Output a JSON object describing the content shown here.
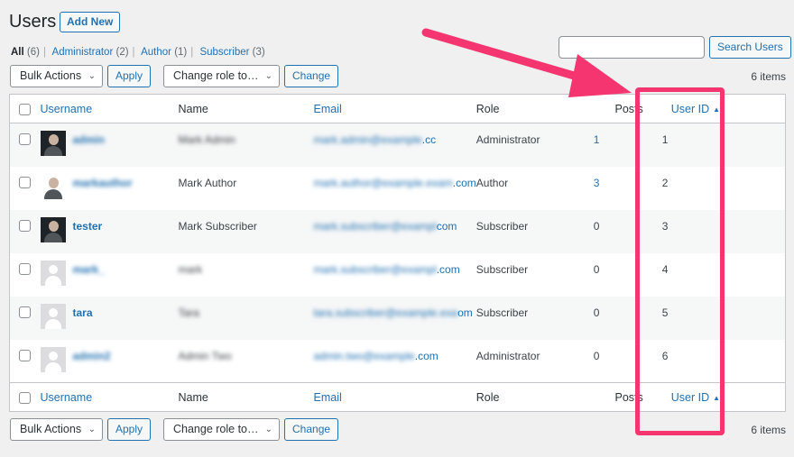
{
  "header": {
    "title": "Users",
    "add_new_label": "Add New"
  },
  "filters": [
    {
      "label": "All",
      "count": "(6)"
    },
    {
      "label": "Administrator",
      "count": "(2)"
    },
    {
      "label": "Author",
      "count": "(1)"
    },
    {
      "label": "Subscriber",
      "count": "(3)"
    }
  ],
  "search": {
    "button_label": "Search Users",
    "value": ""
  },
  "tablenav": {
    "bulk_actions_label": "Bulk Actions",
    "apply_label": "Apply",
    "change_role_label": "Change role to…",
    "change_label": "Change",
    "items_count": "6 items"
  },
  "columns": {
    "username": "Username",
    "name": "Name",
    "email": "Email",
    "role": "Role",
    "posts": "Posts",
    "user_id": "User ID"
  },
  "rows": [
    {
      "username": "admin",
      "name": "Mark Admin",
      "email_a": "mark.admin@example",
      "email_b": ".cc",
      "role": "Administrator",
      "posts": "1",
      "user_id": "1",
      "avatar": "photo"
    },
    {
      "username": "markauthor",
      "name": "Mark Author",
      "email_a": "mark.author@example.exam",
      "email_b": ".com",
      "role": "Author",
      "posts": "3",
      "user_id": "2",
      "avatar": "photo-light"
    },
    {
      "username": "tester",
      "name": "Mark Subscriber",
      "email_a": "mark.subscriber@exampl",
      "email_b": "com",
      "role": "Subscriber",
      "posts": "0",
      "user_id": "3",
      "avatar": "photo"
    },
    {
      "username": "mark_",
      "name": "mark",
      "email_a": "mark.subscriber@exampl",
      "email_b": ".com",
      "role": "Subscriber",
      "posts": "0",
      "user_id": "4",
      "avatar": "default"
    },
    {
      "username": "tara",
      "name": "Tara",
      "email_a": "tara.subscriber@example.exa",
      "email_b": "om",
      "role": "Subscriber",
      "posts": "0",
      "user_id": "5",
      "avatar": "default"
    },
    {
      "username": "admin2",
      "name": "Admin Two",
      "email_a": "admin.two@example",
      "email_b": ".com",
      "role": "Administrator",
      "posts": "0",
      "user_id": "6",
      "avatar": "default"
    }
  ],
  "colors": {
    "link": "#2271b1",
    "highlight": "#f5356f",
    "background": "#f0f0f1"
  }
}
